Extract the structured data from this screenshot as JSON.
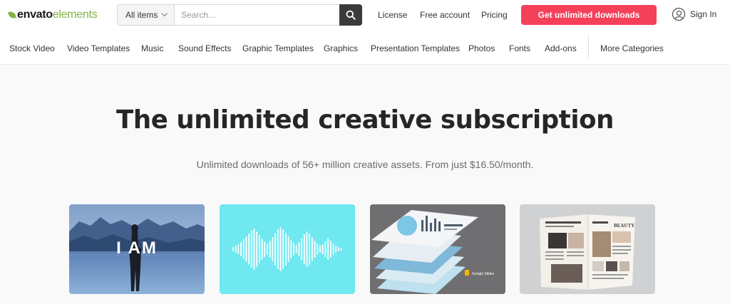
{
  "logo": {
    "envato": "envato",
    "elements": "elements"
  },
  "search": {
    "category": "All items",
    "placeholder": "Search..."
  },
  "header_links": {
    "license": "License",
    "free_account": "Free account",
    "pricing": "Pricing"
  },
  "cta_label": "Get unlimited downloads",
  "sign_in": "Sign In",
  "nav": [
    "Stock Video",
    "Video Templates",
    "Music",
    "Sound Effects",
    "Graphic Templates",
    "Graphics",
    "Presentation Templates",
    "Photos",
    "Fonts",
    "Add-ons",
    "More Categories"
  ],
  "hero": {
    "title": "The unlimited creative subscription",
    "subtitle": "Unlimited downloads of 56+ million creative assets. From just $16.50/month."
  },
  "cards": {
    "stock_video_text": "I AM",
    "presentation_badge": "Google Slides",
    "magazine_heading": "BEAUTY"
  },
  "colors": {
    "accent": "#f5405a",
    "brand_green": "#82b541",
    "audio_bg": "#6fe8f0"
  }
}
